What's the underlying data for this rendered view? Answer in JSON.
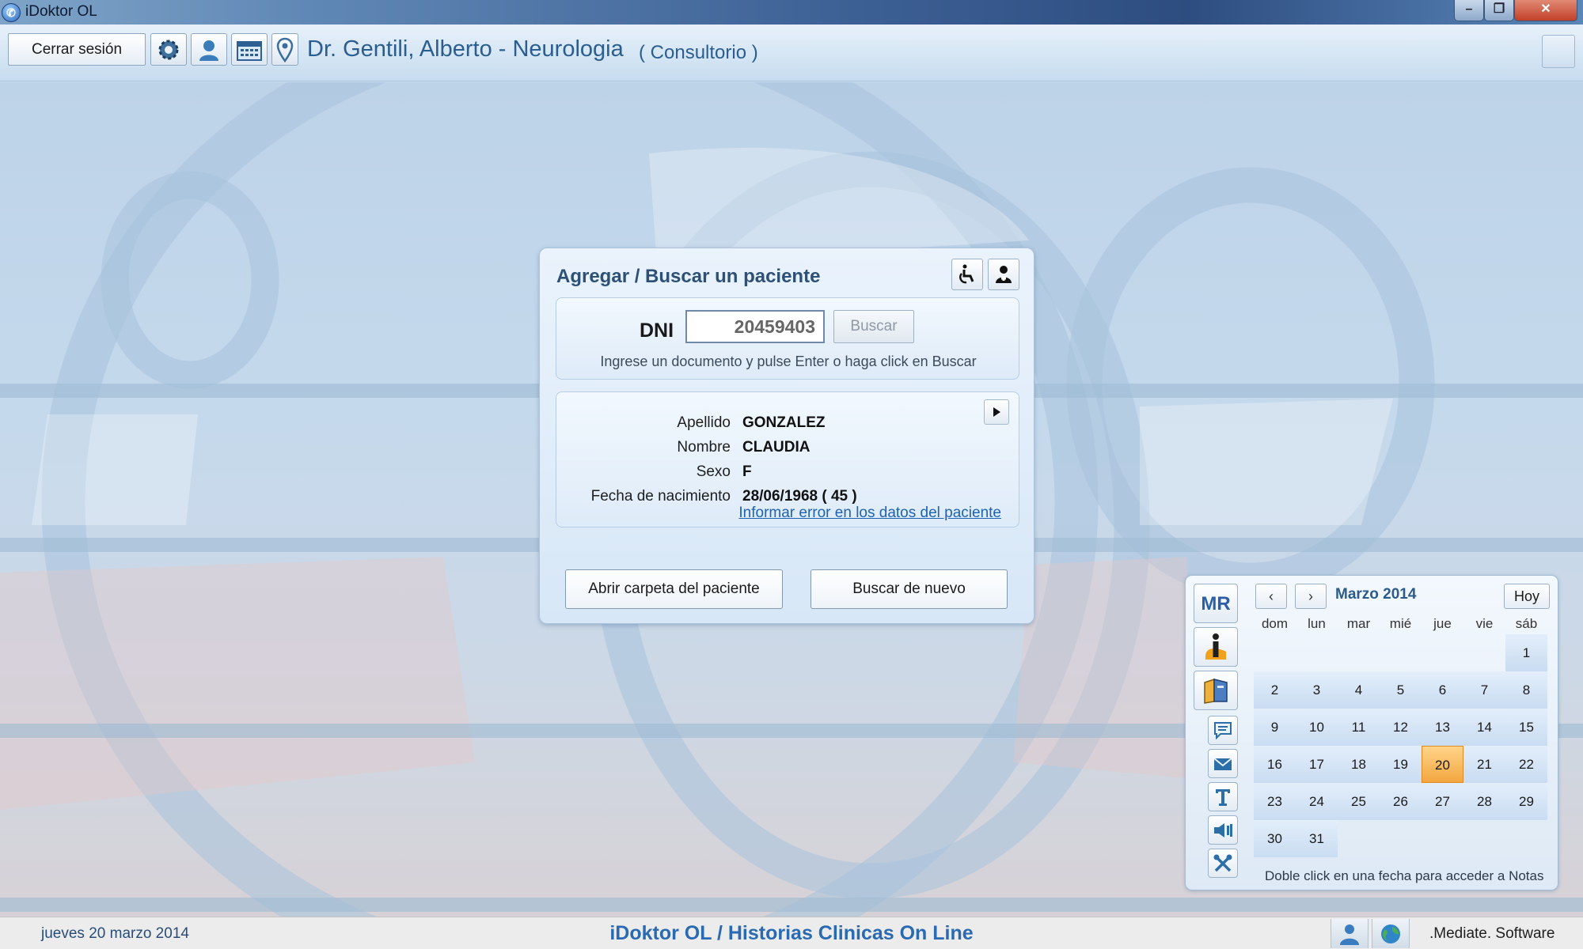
{
  "window": {
    "title": "iDoktor OL",
    "minimize": "–",
    "maximize": "❐",
    "close": "✕"
  },
  "toolbar": {
    "logout_label": "Cerrar sesión",
    "doctor_name": "Dr. Gentili, Alberto - Neurologia",
    "location": "( Consultorio )",
    "icons": [
      "gear-icon",
      "user-icon",
      "calendar-icon",
      "location-pin-icon"
    ]
  },
  "dialog": {
    "title": "Agregar / Buscar un paciente",
    "icons": [
      "wheelchair-icon",
      "patient-icon"
    ],
    "dni_label": "DNI",
    "dni_value": "20459403",
    "search_label": "Buscar",
    "hint": "Ingrese un documento y pulse Enter o haga click en Buscar",
    "patient": {
      "surname_label": "Apellido",
      "surname": "GONZALEZ",
      "name_label": "Nombre",
      "name": "CLAUDIA",
      "sex_label": "Sexo",
      "sex": "F",
      "birth_label": "Fecha de nacimiento",
      "birth": "28/06/1968 ( 45 )"
    },
    "report_link": "Informar error en los datos del paciente",
    "open_folder_label": "Abrir carpeta del paciente",
    "search_again_label": "Buscar de nuevo"
  },
  "calendar": {
    "side_icons": [
      "mr-icon",
      "info-icon",
      "book-icon",
      "chat-icon",
      "mail-icon",
      "text-icon",
      "speaker-icon",
      "tools-icon"
    ],
    "mr_label": "MR",
    "prev_label": "‹",
    "next_label": "›",
    "month": "Marzo 2014",
    "today_label": "Hoy",
    "weekdays": [
      "dom",
      "lun",
      "mar",
      "mié",
      "jue",
      "vie",
      "sáb"
    ],
    "weeks": [
      [
        "",
        "",
        "",
        "",
        "",
        "",
        "1"
      ],
      [
        "2",
        "3",
        "4",
        "5",
        "6",
        "7",
        "8"
      ],
      [
        "9",
        "10",
        "11",
        "12",
        "13",
        "14",
        "15"
      ],
      [
        "16",
        "17",
        "18",
        "19",
        "20",
        "21",
        "22"
      ],
      [
        "23",
        "24",
        "25",
        "26",
        "27",
        "28",
        "29"
      ],
      [
        "30",
        "31",
        "",
        "",
        "",
        "",
        ""
      ]
    ],
    "selected_day": "20",
    "footer": "Doble click en una fecha para acceder a Notas",
    "accent": "#f3a640"
  },
  "status": {
    "date": "jueves 20 marzo 2014",
    "app": "iDoktor OL  /  Historias Clinicas On Line",
    "icons": [
      "users-icon",
      "globe-icon"
    ],
    "vendor": ".Mediate. Software"
  }
}
